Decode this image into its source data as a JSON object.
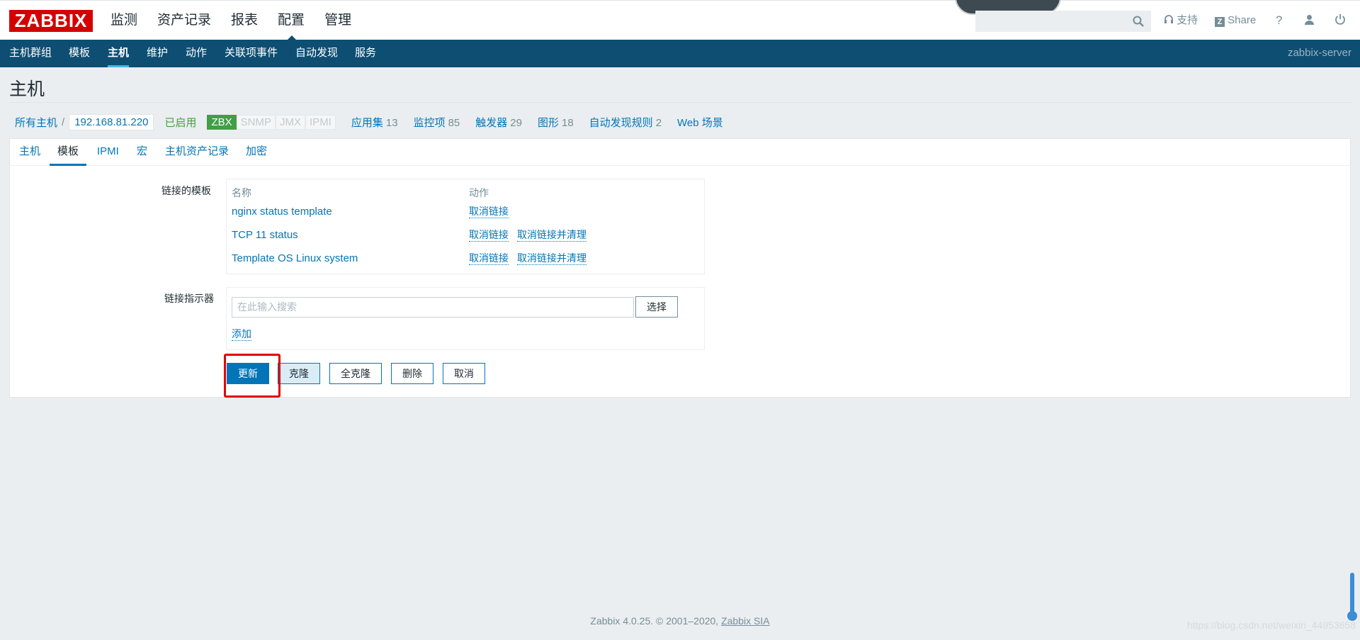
{
  "logo": "ZABBIX",
  "main_menu": [
    "监测",
    "资产记录",
    "报表",
    "配置",
    "管理"
  ],
  "main_menu_active": "配置",
  "top_links": {
    "support": "支持",
    "share": "Share",
    "help": "?"
  },
  "sub_menu": [
    "主机群组",
    "模板",
    "主机",
    "维护",
    "动作",
    "关联项事件",
    "自动发现",
    "服务"
  ],
  "server_name": "zabbix-server",
  "page_title": "主机",
  "breadcrumb": {
    "all_hosts": "所有主机",
    "separator": "/",
    "current": "192.168.81.220"
  },
  "status": "已启用",
  "availability": [
    "ZBX",
    "SNMP",
    "JMX",
    "IPMI"
  ],
  "host_links": [
    {
      "label": "应用集",
      "count": "13"
    },
    {
      "label": "监控项",
      "count": "85"
    },
    {
      "label": "触发器",
      "count": "29"
    },
    {
      "label": "图形",
      "count": "18"
    },
    {
      "label": "自动发现规则",
      "count": "2"
    },
    {
      "label": "Web 场景",
      "count": ""
    }
  ],
  "tabs": [
    "主机",
    "模板",
    "IPMI",
    "宏",
    "主机资产记录",
    "加密"
  ],
  "tab_active": "模板",
  "linked_templates": {
    "label": "链接的模板",
    "col_name": "名称",
    "col_action": "动作",
    "rows": [
      {
        "name": "nginx status template",
        "unlink": "取消链接",
        "unlink_clear": ""
      },
      {
        "name": "TCP 11 status",
        "unlink": "取消链接",
        "unlink_clear": "取消链接并清理"
      },
      {
        "name": "Template OS Linux system",
        "unlink": "取消链接",
        "unlink_clear": "取消链接并清理"
      }
    ]
  },
  "link_new": {
    "label": "链接指示器",
    "placeholder": "在此输入搜索",
    "select_button": "选择",
    "add_link": "添加"
  },
  "buttons": {
    "update": "更新",
    "clone": "克隆",
    "full_clone": "全克隆",
    "delete": "删除",
    "cancel": "取消"
  },
  "footer": {
    "text": "Zabbix 4.0.25. © 2001–2020,",
    "company": "Zabbix SIA"
  },
  "watermark": "https://blog.csdn.net/weixin_44953658",
  "colors": {
    "brand_red": "#d40000",
    "nav_blue": "#0e4e72",
    "link_blue": "#0275b8",
    "enabled_green": "#3fa339",
    "highlight_red": "#e00000"
  }
}
